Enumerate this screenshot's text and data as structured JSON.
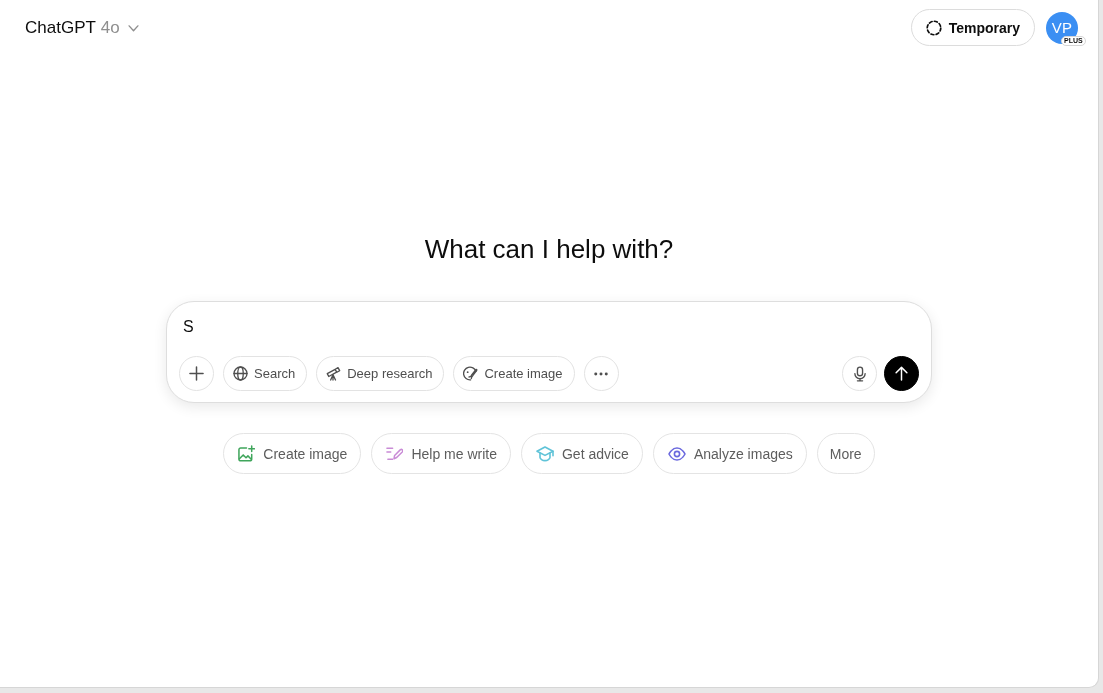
{
  "header": {
    "title": "ChatGPT",
    "model": "4o",
    "temporary_button": "Temporary",
    "avatar": {
      "initials": "VP",
      "badge": "PLUS"
    }
  },
  "heading": "What can I help with?",
  "composer": {
    "value": "S",
    "tools": [
      {
        "kind": "search",
        "label": "Search"
      },
      {
        "kind": "research",
        "label": "Deep research"
      },
      {
        "kind": "image",
        "label": "Create image"
      }
    ]
  },
  "suggestions": [
    {
      "kind": "image",
      "label": "Create image",
      "color": "#3fa55b"
    },
    {
      "kind": "write",
      "label": "Help me write",
      "color": "#c98bd6"
    },
    {
      "kind": "advice",
      "label": "Get advice",
      "color": "#5fc3d8"
    },
    {
      "kind": "analyze",
      "label": "Analyze images",
      "color": "#6b69de"
    },
    {
      "kind": "more",
      "label": "More"
    }
  ]
}
